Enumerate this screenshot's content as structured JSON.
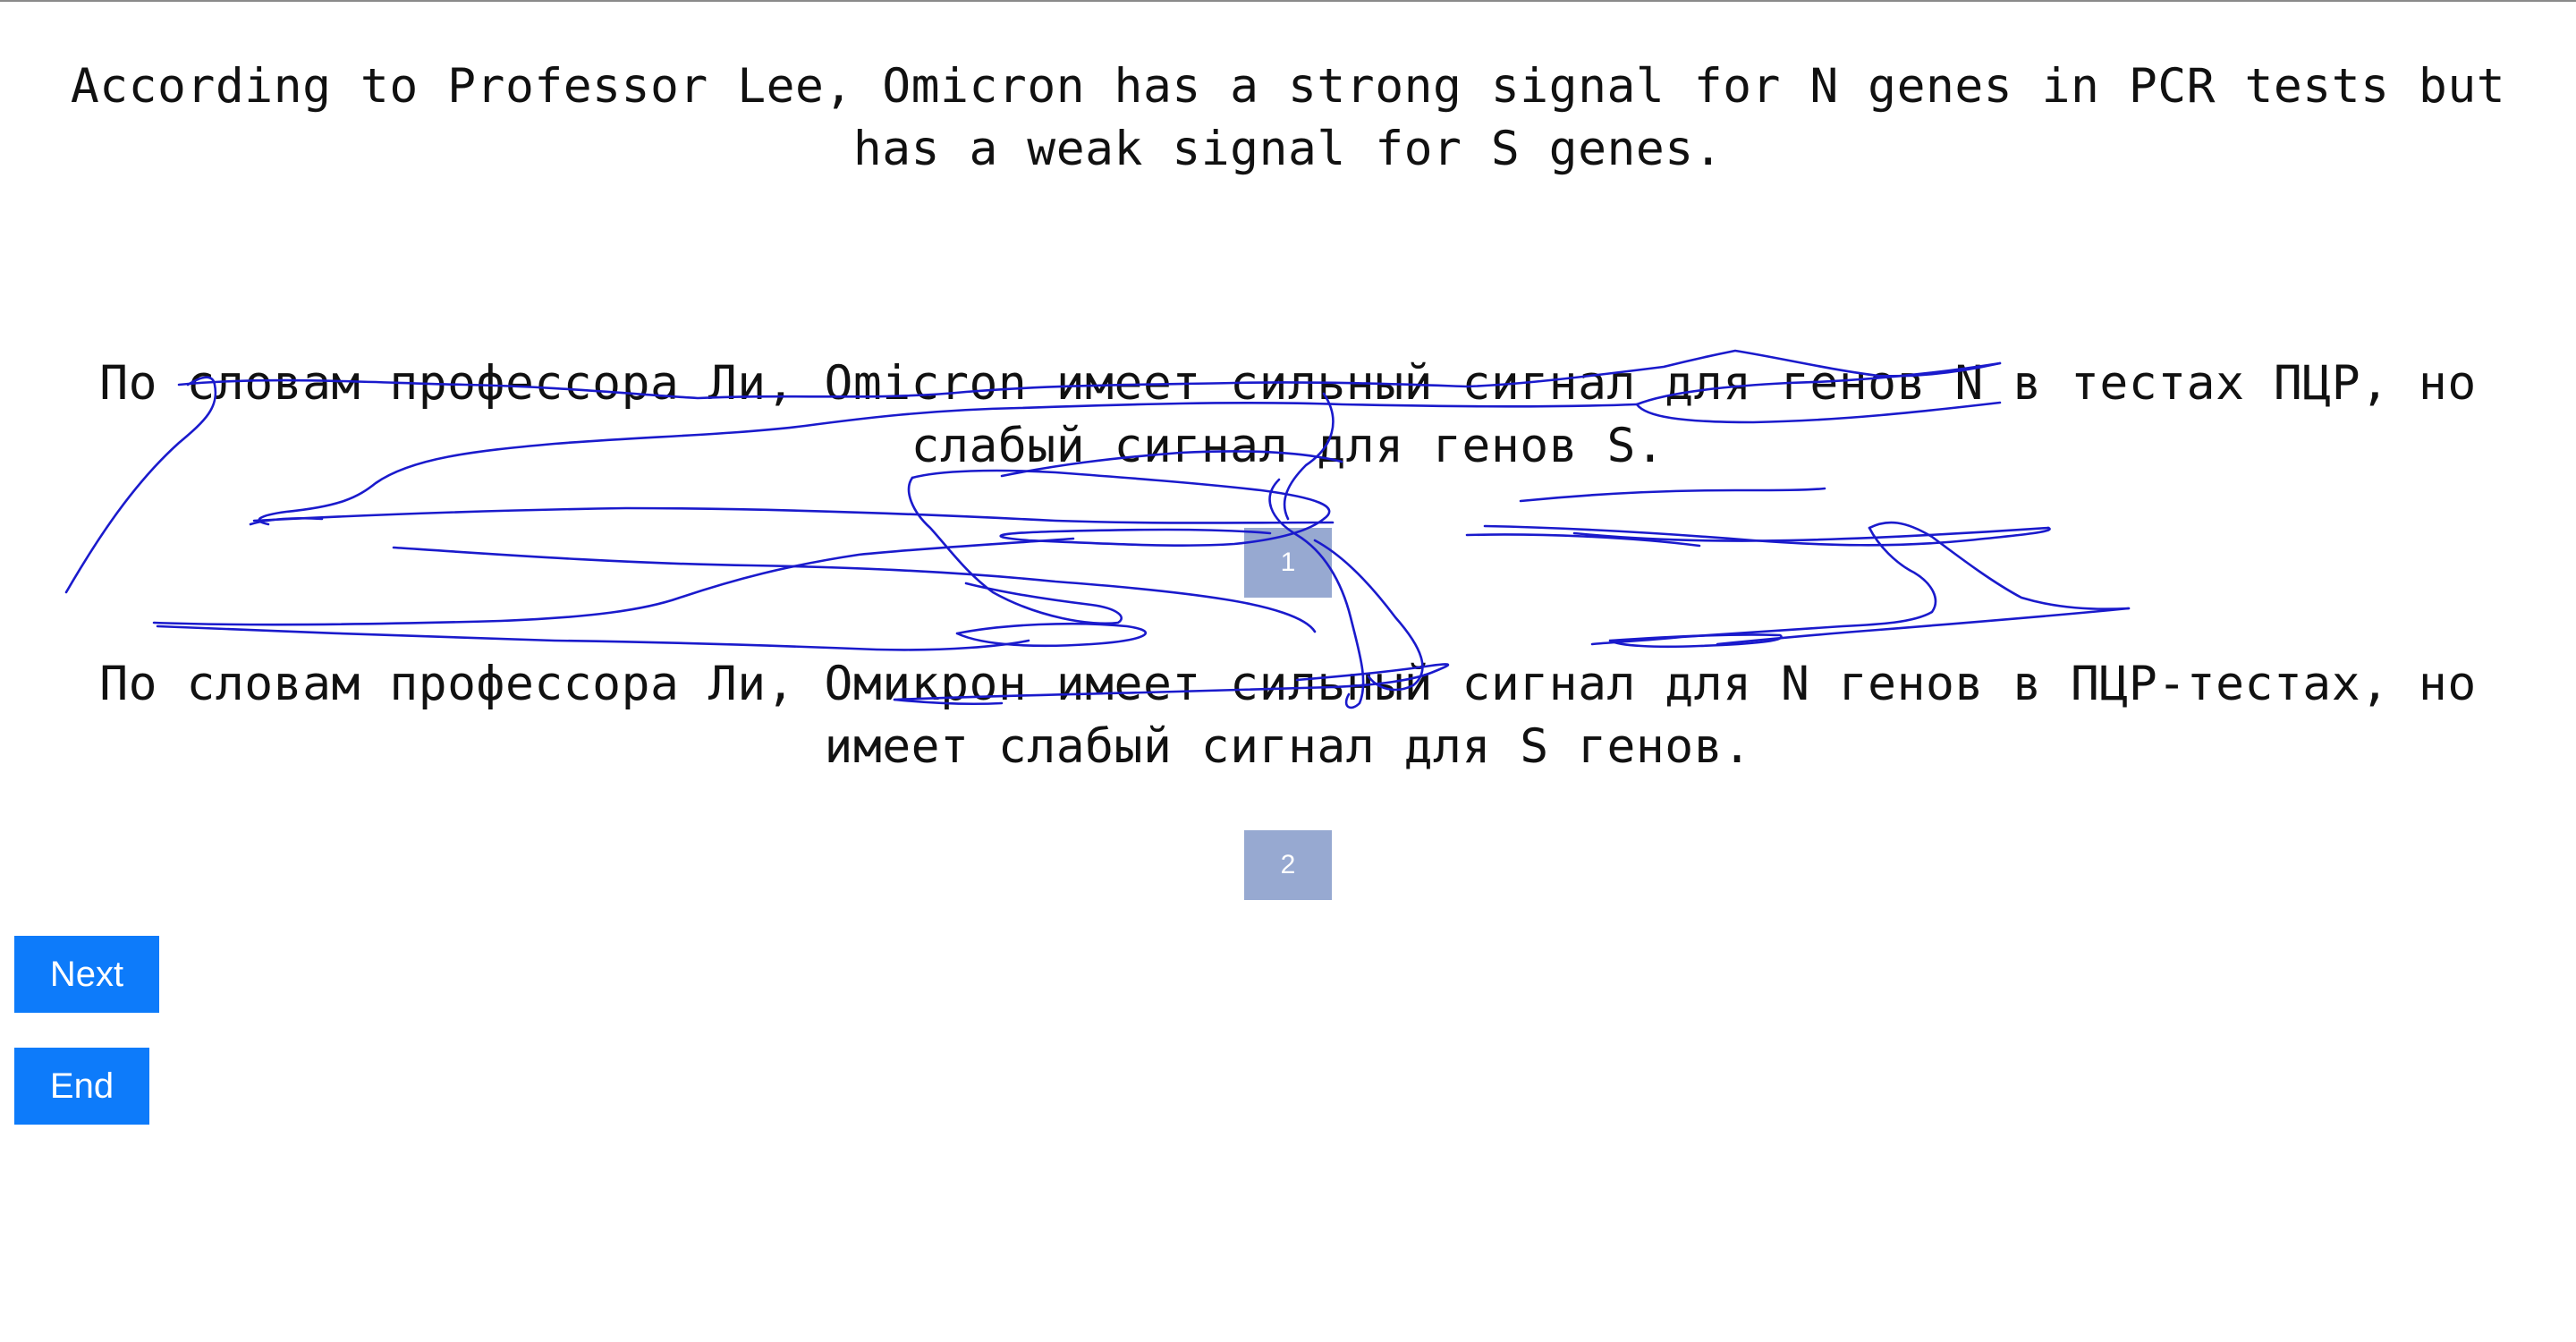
{
  "source": {
    "text": "According to Professor Lee, Omicron has a strong signal for N genes in PCR tests but has a weak signal for S genes."
  },
  "translations": [
    {
      "text": "По словам профессора Ли, Omicron имеет сильный сигнал для генов N в тестах ПЦР, но слабый сигнал для генов S.",
      "number": "1",
      "crossed_out": true
    },
    {
      "text": "По словам профессора Ли, Омикрон имеет сильный сигнал для N генов в ПЦР-тестах, но имеет слабый сигнал для S генов.",
      "number": "2",
      "crossed_out": false
    }
  ],
  "buttons": {
    "next_label": "Next",
    "end_label": "End"
  },
  "colors": {
    "badge": "#97a9d1",
    "button": "#0d7bfa",
    "annotation_ink": "#1a1acc"
  }
}
